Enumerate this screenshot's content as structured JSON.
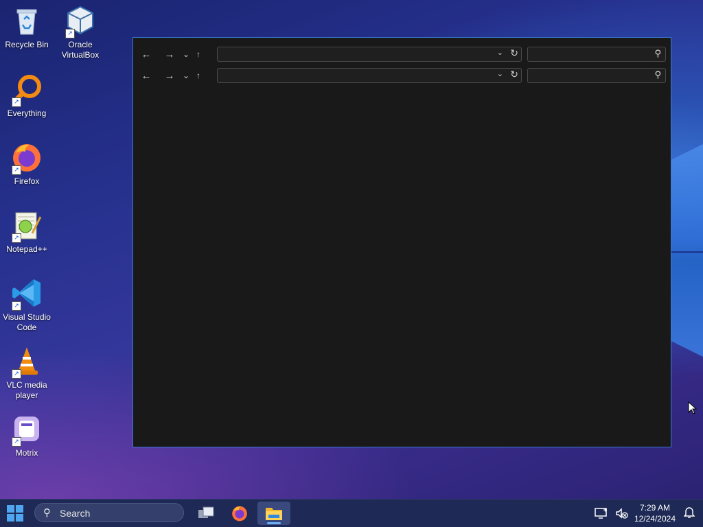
{
  "desktop": {
    "icons": [
      {
        "label": "Recycle Bin",
        "icon": "recycle-bin-icon"
      },
      {
        "label": "Oracle VirtualBox",
        "icon": "virtualbox-icon"
      },
      {
        "label": "Everything",
        "icon": "everything-search-icon"
      },
      {
        "label": "Firefox",
        "icon": "firefox-icon"
      },
      {
        "label": "Notepad++",
        "icon": "notepad-plus-plus-icon"
      },
      {
        "label": "Visual Studio Code",
        "icon": "vscode-icon"
      },
      {
        "label": "VLC media player",
        "icon": "vlc-icon"
      },
      {
        "label": "Motrix",
        "icon": "motrix-icon"
      }
    ]
  },
  "explorer": {
    "rows": [
      {
        "address": "",
        "search": ""
      },
      {
        "address": "",
        "search": ""
      }
    ]
  },
  "taskbar": {
    "search_label": "Search",
    "apps": [
      {
        "name": "task-view-icon"
      },
      {
        "name": "firefox-icon"
      },
      {
        "name": "file-explorer-icon",
        "active": true
      }
    ],
    "clock": {
      "time": "7:29 AM",
      "date": "12/24/2024"
    }
  },
  "colors": {
    "accent": "#3a7bd5",
    "window_bg": "#191919",
    "taskbar_bg": "#1e2a55"
  }
}
